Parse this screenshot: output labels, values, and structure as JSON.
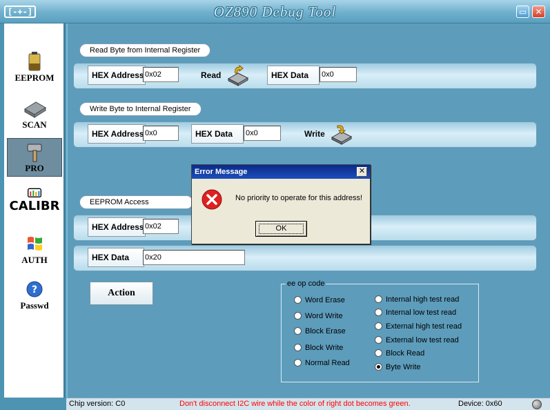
{
  "window": {
    "title": "OZ890 Debug Tool",
    "icon_text": "[-+-]",
    "minimize_glyph": "▭",
    "close_glyph": "✕"
  },
  "nav": {
    "items": [
      {
        "label": "EEPROM",
        "icon": "battery-icon"
      },
      {
        "label": "SCAN",
        "icon": "chip-icon"
      },
      {
        "label": "PRO",
        "icon": "hammer-icon",
        "active": true
      },
      {
        "label": "CALIBR",
        "icon": "meter-icon"
      },
      {
        "label": "AUTH",
        "icon": "windows-flag-icon"
      },
      {
        "label": "Passwd",
        "icon": "help-icon"
      }
    ]
  },
  "read_section": {
    "title": "Read Byte from Internal Register",
    "hex_address_label": "HEX Address",
    "hex_address_value": "0x02",
    "read_label": "Read",
    "hex_data_label": "HEX Data",
    "hex_data_value": "0x0"
  },
  "write_section": {
    "title": "Write Byte to Internal Register",
    "hex_address_label": "HEX Address",
    "hex_address_value": "0x0",
    "hex_data_label": "HEX Data",
    "hex_data_value": "0x0",
    "write_label": "Write"
  },
  "eeprom_section": {
    "title": "EEPROM Access",
    "hex_address_label": "HEX Address",
    "hex_address_value": "0x02",
    "hex_data_label": "HEX Data",
    "hex_data_value": "0x20",
    "action_label": "Action"
  },
  "op_code": {
    "legend": "ee op code",
    "left_options": [
      "Word Erase",
      "Word Write",
      "Block Erase",
      "Block Write",
      "Normal Read"
    ],
    "right_options": [
      "Internal high test read",
      "Internal low test read",
      "External high test read",
      "External low test read",
      "Block Read",
      "Byte Write"
    ],
    "selected": "Byte Write"
  },
  "status": {
    "chip_version": "Chip version: C0",
    "warning": "Don't disconnect I2C wire while the color of right dot becomes green.",
    "device": "Device: 0x60",
    "warning_color": "#ff0000"
  },
  "dialog": {
    "title": "Error Message",
    "message": "No priority to operate for this address!",
    "ok_label": "OK",
    "close_glyph": "✕",
    "icon": "error-icon"
  }
}
